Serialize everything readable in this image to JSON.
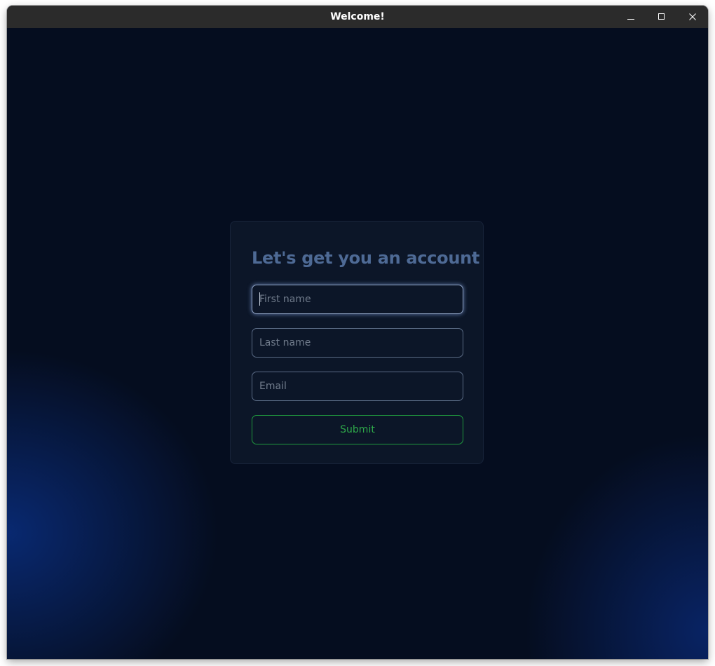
{
  "window": {
    "title": "Welcome!",
    "controls": [
      "minimize-icon",
      "maximize-icon",
      "close-icon"
    ]
  },
  "form": {
    "heading": "Let's get you an account",
    "first_name": {
      "value": "",
      "placeholder": "First name",
      "focused": true
    },
    "last_name": {
      "value": "",
      "placeholder": "Last name"
    },
    "email": {
      "value": "",
      "placeholder": "Email"
    },
    "submit_label": "Submit"
  },
  "colors": {
    "background": "#050d1f",
    "card": "#0c1628",
    "heading": "#4e6a95",
    "submit_accent": "#2ea84a",
    "titlebar": "#2b2b2b"
  }
}
